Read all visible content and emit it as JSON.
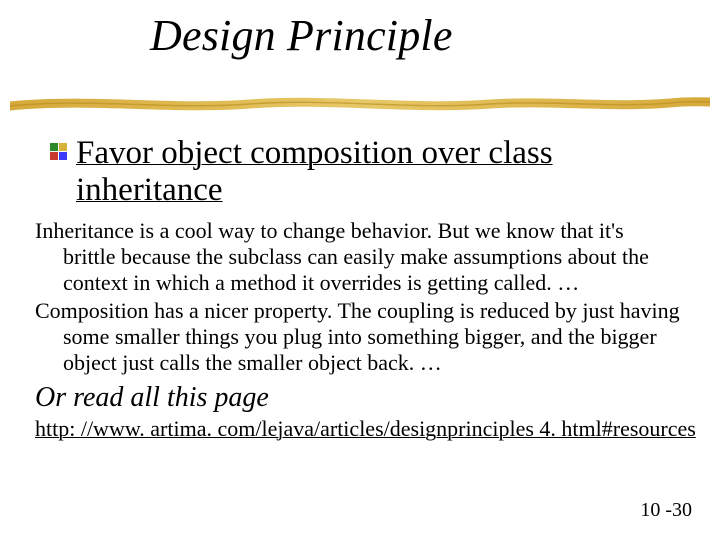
{
  "slide": {
    "title": "Design Principle",
    "bullet": "Favor object composition over class inheritance",
    "body1": "Inheritance is a cool way to change behavior. But we know that it's brittle because the subclass can easily make assumptions about the context in which a method it overrides is getting called.  …",
    "body2": "Composition has a nicer property. The coupling is reduced by just having some smaller things you plug into something bigger, and the bigger object just calls the smaller object back.  …",
    "read_more": "Or read all this page",
    "url": "http: //www. artima. com/lejava/articles/designprinciples 4. html#resources",
    "page_number": "10 -30"
  }
}
